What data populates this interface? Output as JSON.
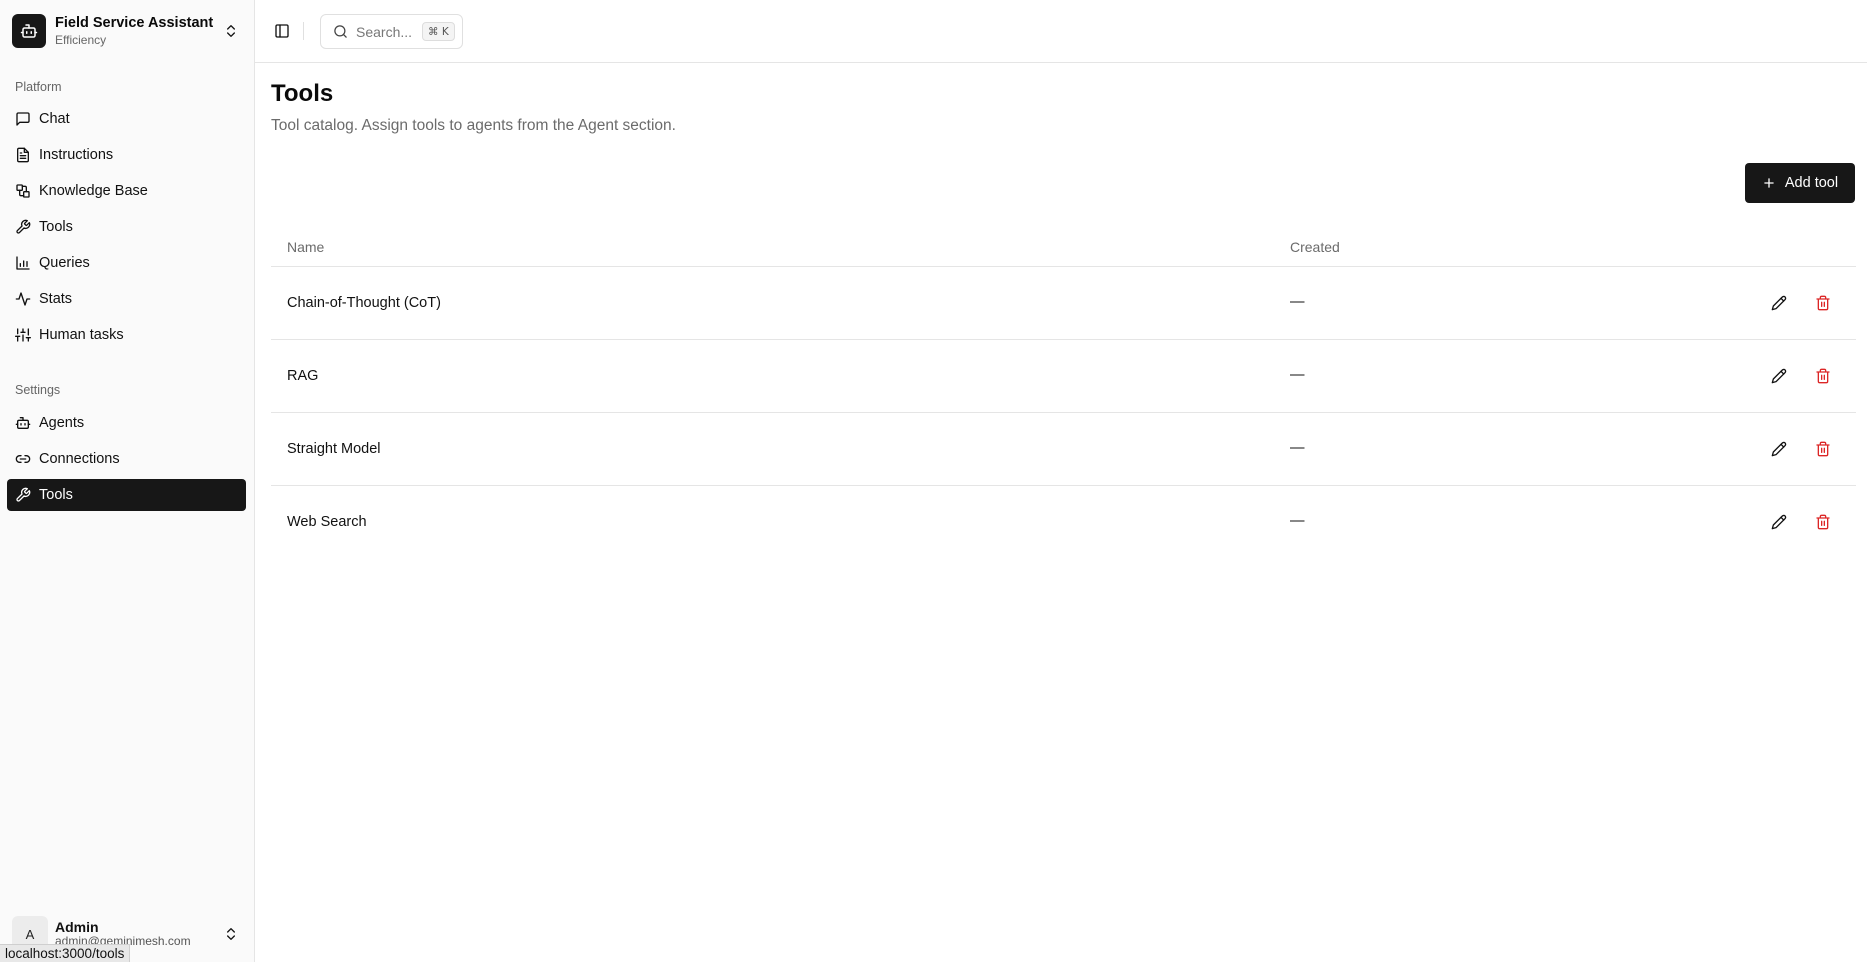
{
  "app": {
    "title": "Field Service Assistant",
    "subtitle": "Efficiency"
  },
  "sidebar": {
    "platform_label": "Platform",
    "platform_items": [
      {
        "label": "Chat",
        "icon": "message-square-icon"
      },
      {
        "label": "Instructions",
        "icon": "file-text-icon"
      },
      {
        "label": "Knowledge Base",
        "icon": "library-icon"
      },
      {
        "label": "Tools",
        "icon": "wrench-icon"
      },
      {
        "label": "Queries",
        "icon": "bar-chart-icon"
      },
      {
        "label": "Stats",
        "icon": "activity-icon"
      },
      {
        "label": "Human tasks",
        "icon": "sliders-icon"
      }
    ],
    "settings_label": "Settings",
    "settings_items": [
      {
        "label": "Agents",
        "icon": "bot-icon"
      },
      {
        "label": "Connections",
        "icon": "link-icon"
      },
      {
        "label": "Tools",
        "icon": "wrench-icon",
        "active": true
      }
    ]
  },
  "user": {
    "initial": "A",
    "name": "Admin",
    "email": "admin@geminimesh.com"
  },
  "status_bar": {
    "url": "localhost:3000/tools"
  },
  "header": {
    "search_placeholder": "Search...",
    "search_shortcut": "⌘ K"
  },
  "page": {
    "title": "Tools",
    "description": "Tool catalog. Assign tools to agents from the Agent section.",
    "add_button": "Add tool"
  },
  "table": {
    "columns": {
      "name": "Name",
      "created": "Created"
    },
    "rows": [
      {
        "name": "Chain-of-Thought (CoT)",
        "created": "—"
      },
      {
        "name": "RAG",
        "created": "—"
      },
      {
        "name": "Straight Model",
        "created": "—"
      },
      {
        "name": "Web Search",
        "created": "—"
      }
    ]
  },
  "colors": {
    "primary": "#171717",
    "delete": "#dc2626",
    "muted_text": "#6b6b6b",
    "border": "#e5e5e5"
  }
}
